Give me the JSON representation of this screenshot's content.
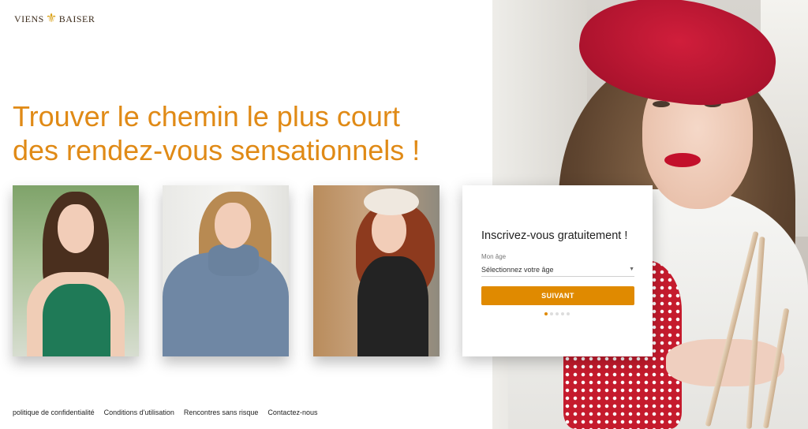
{
  "logo": {
    "text_left": "VIENS",
    "text_right": "BAISER",
    "icon": "fleur-de-lis-icon",
    "icon_color": "#d9a015"
  },
  "headline": {
    "line1": "Trouver le chemin le plus court",
    "line2": "des rendez-vous sensationnels !",
    "color": "#e08a16"
  },
  "photos": [
    {
      "alt": "woman-green-top"
    },
    {
      "alt": "woman-blue-sweater"
    },
    {
      "alt": "woman-beret-black-top"
    }
  ],
  "signup": {
    "title": "Inscrivez-vous gratuitement !",
    "age_label": "Mon âge",
    "age_placeholder": "Sélectionnez votre âge",
    "next_label": "SUIVANT",
    "step_current": 1,
    "step_total": 5,
    "accent": "#e08a00"
  },
  "footer": {
    "links": [
      "politique de confidentialité",
      "Conditions d'utilisation",
      "Rencontres sans risque",
      "Contactez-nous"
    ]
  }
}
